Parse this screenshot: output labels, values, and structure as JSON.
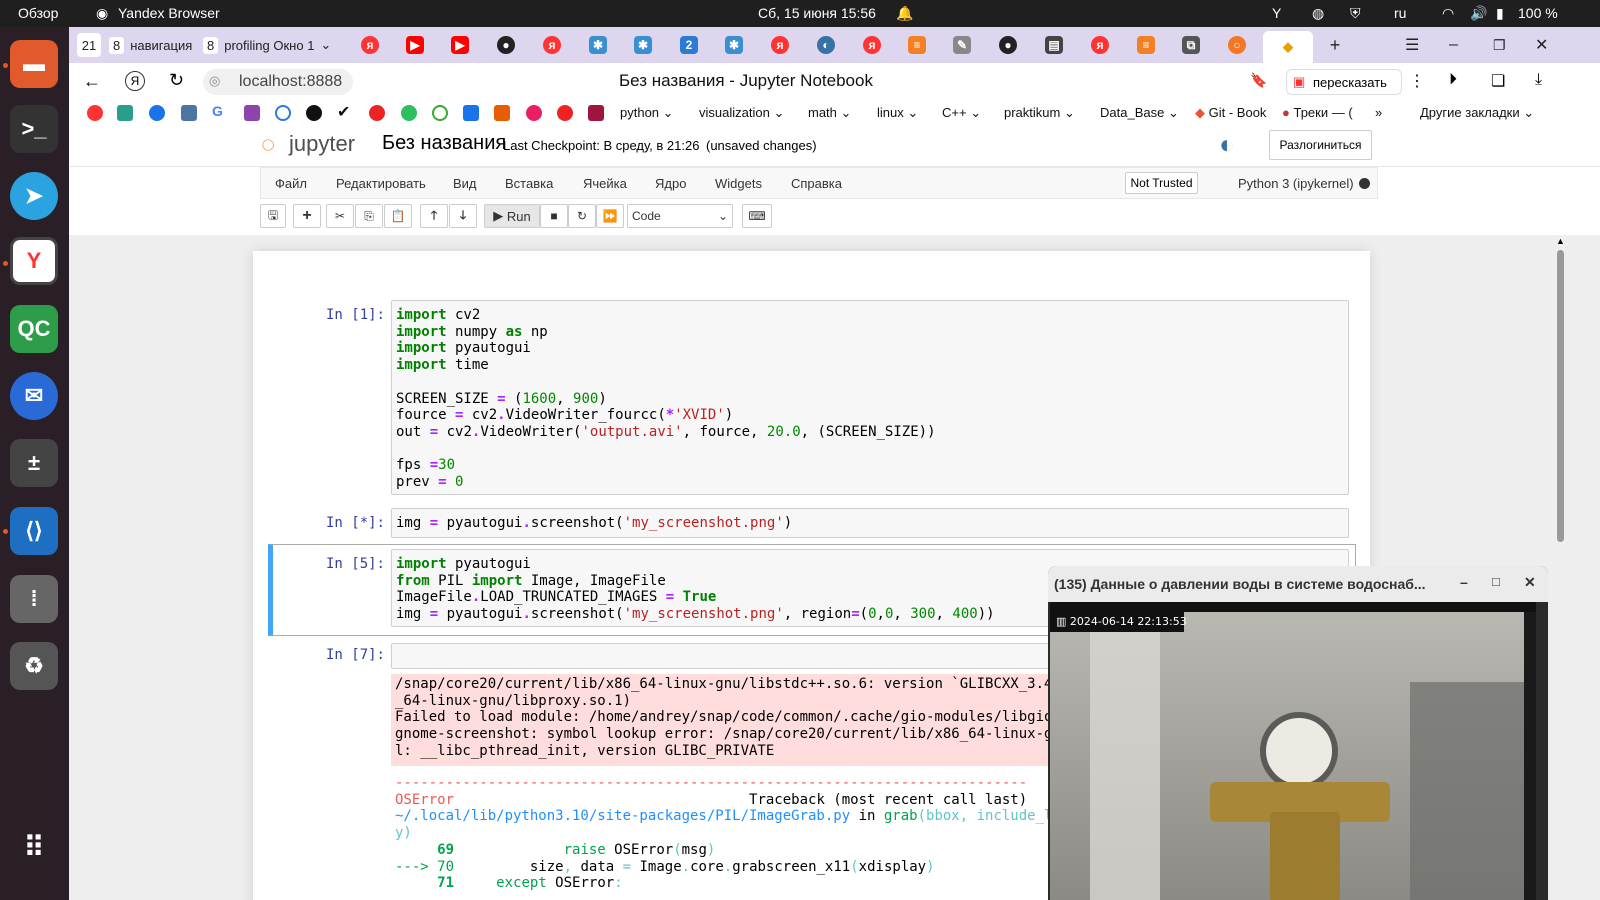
{
  "top_bar": {
    "overview": "Обзор",
    "app": "Yandex Browser",
    "datetime": "Сб, 15 июня  15:56",
    "lang": "ru",
    "battery": "100 %"
  },
  "tabs": {
    "group1_count": "21",
    "group2_count": "8",
    "group2_label": "навигация",
    "group3_count": "8",
    "group3_label": "profiling Окно 1",
    "new_tab": "+"
  },
  "address": {
    "url": "localhost:8888",
    "page_title": "Без названия - Jupyter Notebook",
    "translate_label": "пересказать"
  },
  "bookmarks": {
    "folders": [
      "python",
      "visualization",
      "math",
      "linux",
      "C++",
      "praktikum",
      "Data_Base"
    ],
    "git_book": "Git - Book",
    "treki": "Треки — (",
    "more": "»",
    "other": "Другие закладки"
  },
  "jupyter": {
    "logo_text": "jupyter",
    "notebook_name": "Без названия",
    "checkpoint": "Last Checkpoint: В среду, в 21:26",
    "unsaved": "(unsaved changes)",
    "logout": "Разлогиниться",
    "menu": [
      "Файл",
      "Редактировать",
      "Вид",
      "Вставка",
      "Ячейка",
      "Ядро",
      "Widgets",
      "Справка"
    ],
    "trusted": "Not Trusted",
    "kernel": "Python 3 (ipykernel)",
    "run_label": "Run",
    "cell_type": "Code"
  },
  "cells": [
    {
      "prompt": "In [1]:"
    },
    {
      "prompt": "In [*]:"
    },
    {
      "prompt": "In [5]:"
    },
    {
      "prompt": "In [7]:"
    }
  ],
  "video": {
    "title": "(135) Данные о давлении воды в системе водоснаб...",
    "overlay_time": "2024-06-14  22:13:53"
  },
  "colors": {
    "accent_tab": "#f5c400",
    "jupyter_orange": "#f37726",
    "error_bg": "#ffdddd",
    "dock_bg": "#2a1e27"
  }
}
